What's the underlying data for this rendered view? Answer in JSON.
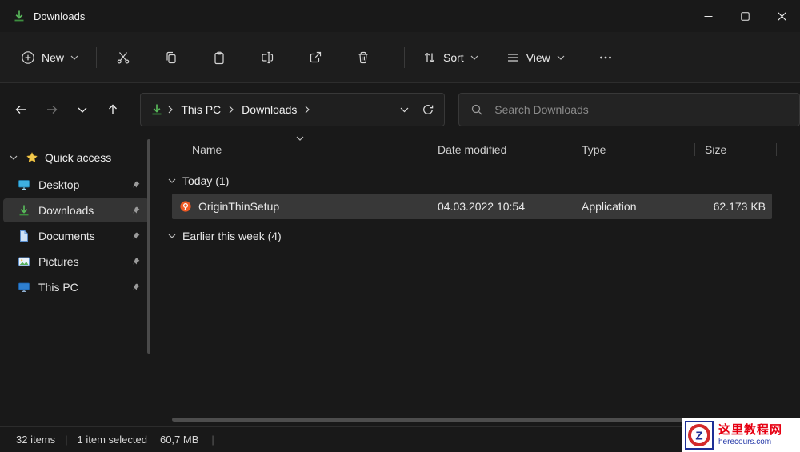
{
  "window": {
    "title": "Downloads"
  },
  "toolbar": {
    "new_label": "New",
    "sort_label": "Sort",
    "view_label": "View"
  },
  "navbar": {
    "breadcrumb_root": "This PC",
    "breadcrumb_current": "Downloads",
    "search_placeholder": "Search Downloads"
  },
  "sidebar": {
    "quick_access_label": "Quick access",
    "items": [
      {
        "label": "Desktop"
      },
      {
        "label": "Downloads"
      },
      {
        "label": "Documents"
      },
      {
        "label": "Pictures"
      },
      {
        "label": "This PC"
      }
    ]
  },
  "main": {
    "columns": {
      "name": "Name",
      "date_modified": "Date modified",
      "type": "Type",
      "size": "Size"
    },
    "groups": {
      "today_label": "Today (1)",
      "earlier_label": "Earlier this week (4)"
    },
    "selected_file": {
      "name": "OriginThinSetup",
      "date_modified": "04.03.2022 10:54",
      "type": "Application",
      "size": "62.173 KB"
    }
  },
  "statusbar": {
    "item_count": "32 items",
    "selection": "1 item selected",
    "selection_size": "60,7 MB",
    "separator": "|"
  },
  "watermark": {
    "logo_letter": "Z",
    "title": "这里教程网",
    "site": "herecours.com"
  },
  "icons": {
    "download": "↓",
    "new": "⊕",
    "cut": "✂",
    "copy": "⧉",
    "paste": "▣",
    "rename": "✎",
    "share": "↗",
    "delete": "🗑",
    "sort": "⇅",
    "view": "≡",
    "ellipsis": "⋯",
    "back": "←",
    "forward": "→",
    "up": "↑",
    "refresh": "⟳",
    "search": "🔍",
    "star": "★",
    "pin": "📌",
    "chevron_down": "⌄",
    "chevron_right": "›",
    "minimize": "—",
    "maximize": "□",
    "close": "✕"
  },
  "colors": {
    "background": "#191919",
    "selection": "#383838",
    "accent_green": "#54b054",
    "arrow_red": "#c23a3a"
  }
}
